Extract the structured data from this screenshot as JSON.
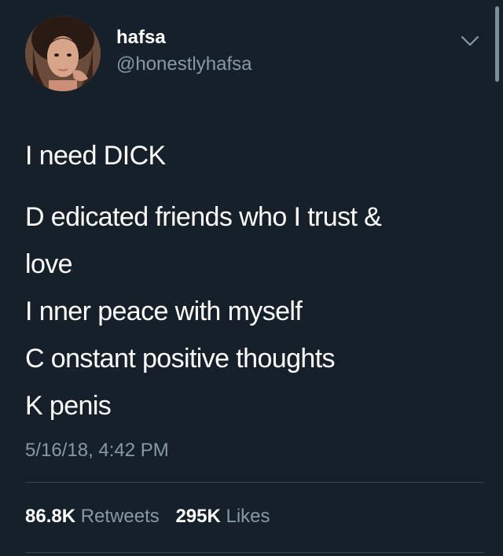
{
  "colors": {
    "background": "#15202b",
    "primary_text": "#ffffff",
    "secondary_text": "#8899a6",
    "divider": "#38444d"
  },
  "user": {
    "display_name": "hafsa",
    "handle": "@honestlyhafsa"
  },
  "tweet": {
    "lines": [
      "I need DICK",
      "D edicated friends who I trust &",
      "love",
      "I nner peace with myself",
      "C onstant positive thoughts",
      "K penis"
    ],
    "timestamp": "5/16/18, 4:42 PM"
  },
  "stats": {
    "retweets_count": "86.8K",
    "retweets_label": "Retweets",
    "likes_count": "295K",
    "likes_label": "Likes"
  },
  "icons": {
    "menu": "chevron-down-icon"
  }
}
